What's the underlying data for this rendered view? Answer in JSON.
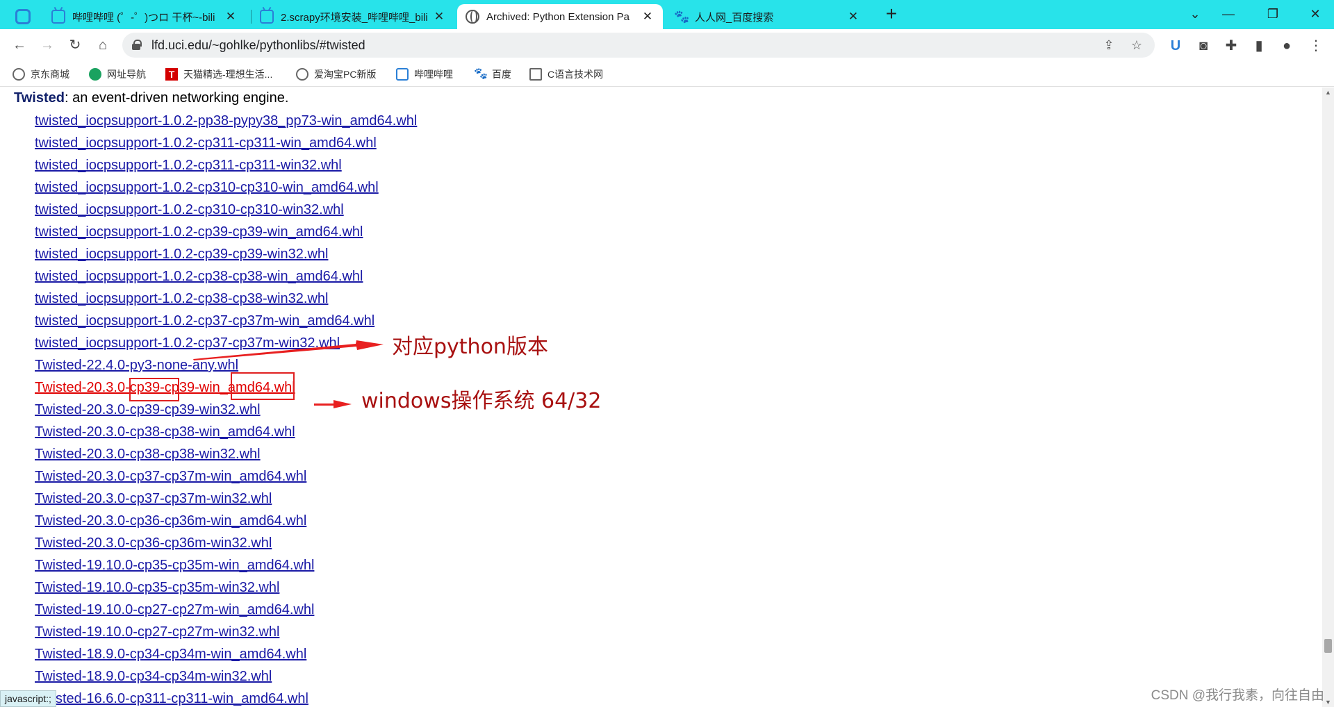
{
  "tabs": [
    {
      "title": "哔哩哔哩 (゜-゜)つロ 干杯~-bili",
      "icon": "bilibili-icon"
    },
    {
      "title": "2.scrapy环境安装_哔哩哔哩_bili",
      "icon": "bilibili-icon"
    },
    {
      "title": "Archived: Python Extension Pa",
      "icon": "globe-icon",
      "active": true
    },
    {
      "title": "人人网_百度搜索",
      "icon": "baidu-paw-icon"
    }
  ],
  "address_bar": {
    "url": "lfd.uci.edu/~gohlke/pythonlibs/#twisted"
  },
  "bookmarks": [
    {
      "label": "京东商城"
    },
    {
      "label": "网址导航"
    },
    {
      "label": "天猫精选-理想生活..."
    },
    {
      "label": "爱淘宝PC新版"
    },
    {
      "label": "哔哩哔哩"
    },
    {
      "label": "百度"
    },
    {
      "label": "C语言技术网"
    }
  ],
  "section": {
    "name": "Twisted",
    "description": ": an event-driven networking engine."
  },
  "packages": [
    "twisted_iocpsupport-1.0.2-pp38-pypy38_pp73-win_amd64.whl",
    "twisted_iocpsupport-1.0.2-cp311-cp311-win_amd64.whl",
    "twisted_iocpsupport-1.0.2-cp311-cp311-win32.whl",
    "twisted_iocpsupport-1.0.2-cp310-cp310-win_amd64.whl",
    "twisted_iocpsupport-1.0.2-cp310-cp310-win32.whl",
    "twisted_iocpsupport-1.0.2-cp39-cp39-win_amd64.whl",
    "twisted_iocpsupport-1.0.2-cp39-cp39-win32.whl",
    "twisted_iocpsupport-1.0.2-cp38-cp38-win_amd64.whl",
    "twisted_iocpsupport-1.0.2-cp38-cp38-win32.whl",
    "twisted_iocpsupport-1.0.2-cp37-cp37m-win_amd64.whl",
    "twisted_iocpsupport-1.0.2-cp37-cp37m-win32.whl",
    "Twisted-22.4.0-py3-none-any.whl",
    "Twisted-20.3.0-cp39-cp39-win_amd64.whl",
    "Twisted-20.3.0-cp39-cp39-win32.whl",
    "Twisted-20.3.0-cp38-cp38-win_amd64.whl",
    "Twisted-20.3.0-cp38-cp38-win32.whl",
    "Twisted-20.3.0-cp37-cp37m-win_amd64.whl",
    "Twisted-20.3.0-cp37-cp37m-win32.whl",
    "Twisted-20.3.0-cp36-cp36m-win_amd64.whl",
    "Twisted-20.3.0-cp36-cp36m-win32.whl",
    "Twisted-19.10.0-cp35-cp35m-win_amd64.whl",
    "Twisted-19.10.0-cp35-cp35m-win32.whl",
    "Twisted-19.10.0-cp27-cp27m-win_amd64.whl",
    "Twisted-19.10.0-cp27-cp27m-win32.whl",
    "Twisted-18.9.0-cp34-cp34m-win_amd64.whl",
    "Twisted-18.9.0-cp34-cp34m-win32.whl",
    "Twisted-16.6.0-cp311-cp311-win_amd64.whl"
  ],
  "annotations": {
    "python_version": "对应python版本",
    "windows_arch": "windows操作系统 64/32"
  },
  "status_text": "javascript:;",
  "watermark": "CSDN @我行我素，向往自由",
  "colors": {
    "tab_strip": "#28e3ea",
    "link": "#1a1aa6",
    "highlight_link": "#e00000",
    "annotation": "#a81010"
  }
}
